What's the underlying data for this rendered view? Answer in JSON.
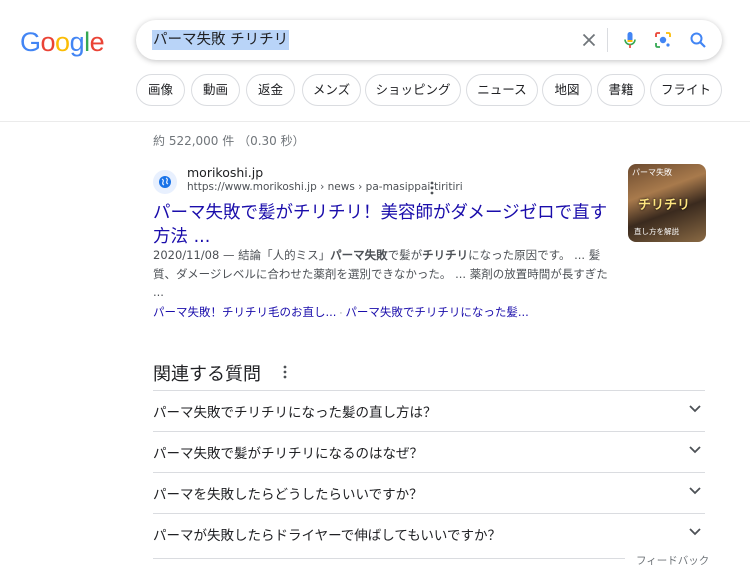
{
  "logo": {
    "letters": [
      "G",
      "o",
      "o",
      "g",
      "l",
      "e"
    ],
    "colors": [
      "#4285F4",
      "#EA4335",
      "#FBBC05",
      "#4285F4",
      "#34A853",
      "#EA4335"
    ]
  },
  "search": {
    "query": "パーマ失敗 チリチリ"
  },
  "icons": {
    "clear": "close-icon",
    "voice": "microphone-icon",
    "lens": "camera-lens-icon",
    "search": "search-icon"
  },
  "chips": [
    "画像",
    "動画",
    "返金",
    "メンズ",
    "ショッピング",
    "ニュース",
    "地図",
    "書籍",
    "フライト"
  ],
  "stats": "約 522,000 件 （0.30 秒）",
  "result": {
    "site_name": "morikoshi.jp",
    "url": "https://www.morikoshi.jp › news › pa-masippai-tiritiri",
    "title": "パーマ失敗で髪がチリチリ！美容師がダメージゼロで直す方法 ...",
    "snippet": {
      "date": "2020/11/08",
      "sep": " — ",
      "p1": "結論「人的ミス」",
      "b1": "パーマ失敗",
      "p2": "で髪が",
      "b2": "チリチリ",
      "p3": "になった原因です。 ... 髪質、ダメージレベルに合わせた薬剤を選別できなかった。 ... 薬剤の放置時間が長すぎた ..."
    },
    "sitelinks": [
      "パーマ失敗！チリチリ毛のお直し...",
      "パーマ失敗でチリチリになった髪..."
    ],
    "thumbnail": {
      "line1": "パーマ失敗",
      "line2": "チリチリ",
      "line3": "直し方を解説"
    }
  },
  "paa": {
    "title": "関連する質問",
    "questions": [
      "パーマ失敗でチリチリになった髪の直し方は？",
      "パーマ失敗で髪がチリチリになるのはなぜ？",
      "パーマを失敗したらどうしたらいいですか？",
      "パーマが失敗したらドライヤーで伸ばしてもいいですか？"
    ]
  },
  "feedback": "フィードバック"
}
